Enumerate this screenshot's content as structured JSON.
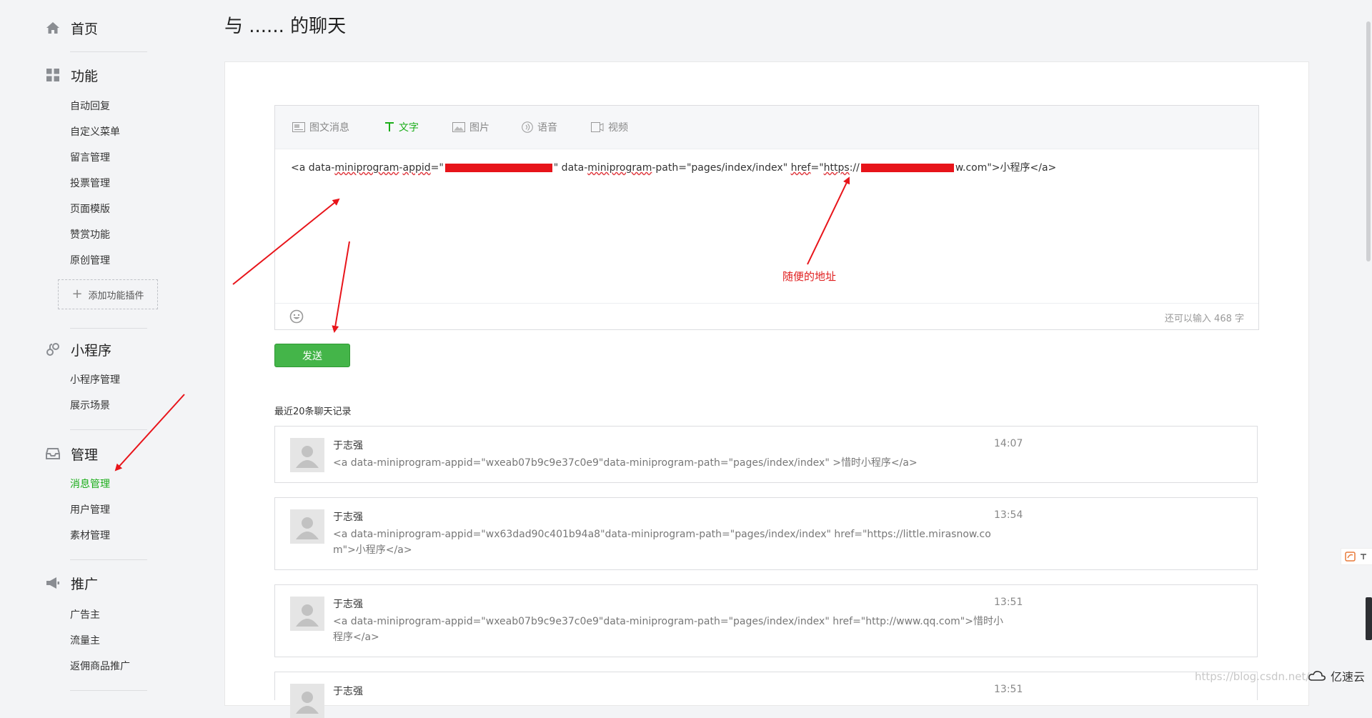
{
  "sidebar": {
    "home": "首页",
    "features": {
      "label": "功能",
      "items": [
        "自动回复",
        "自定义菜单",
        "留言管理",
        "投票管理",
        "页面模版",
        "赞赏功能",
        "原创管理"
      ],
      "add_plugin": "添加功能插件"
    },
    "miniprogram": {
      "label": "小程序",
      "items": [
        "小程序管理",
        "展示场景"
      ]
    },
    "manage": {
      "label": "管理",
      "items": [
        "消息管理",
        "用户管理",
        "素材管理"
      ],
      "active": "消息管理"
    },
    "promote": {
      "label": "推广",
      "items": [
        "广告主",
        "流量主",
        "返佣商品推广"
      ]
    }
  },
  "page_title": "与 ...... 的聊天",
  "editor": {
    "tabs": [
      "图文消息",
      "文字",
      "图片",
      "语音",
      "视频"
    ],
    "active_tab": "文字",
    "text": {
      "part1": "<a data-",
      "w1": "miniprogram",
      "part2": "-",
      "w2": "appid",
      "part3": "=\"",
      "part4": "\" data-",
      "w3": "miniprogram",
      "part5": "-path=\"pages/index/index\"  ",
      "w4": "href",
      "part6": "=\"",
      "w5": "https",
      "part7": "://",
      "part8": "w.com\">小程序</a>"
    },
    "char_count": "还可以输入 468 字"
  },
  "send_label": "发送",
  "annotation": "随便的地址",
  "history": {
    "title": "最近20条聊天记录",
    "messages": [
      {
        "name": "于志强",
        "time": "14:07",
        "body": "<a data-miniprogram-appid=\"wxeab07b9c9e37c0e9\"data-miniprogram-path=\"pages/index/index\" >惜时小程序</a>"
      },
      {
        "name": "于志强",
        "time": "13:54",
        "body": "<a data-miniprogram-appid=\"wx63dad90c401b94a8\"data-miniprogram-path=\"pages/index/index\" href=\"https://little.mirasnow.com\">小程序</a>"
      },
      {
        "name": "于志强",
        "time": "13:51",
        "body": "<a data-miniprogram-appid=\"wxeab07b9c9e37c0e9\"data-miniprogram-path=\"pages/index/index\" href=\"http://www.qq.com\">惜时小程序</a>"
      },
      {
        "name": "于志强",
        "time": "13:51",
        "body": ""
      }
    ]
  },
  "watermark": "https://blog.csdn.net/",
  "brand": "亿速云",
  "colors": {
    "accent": "#1aad19",
    "send": "#44b549",
    "annotation": "#e02020"
  }
}
